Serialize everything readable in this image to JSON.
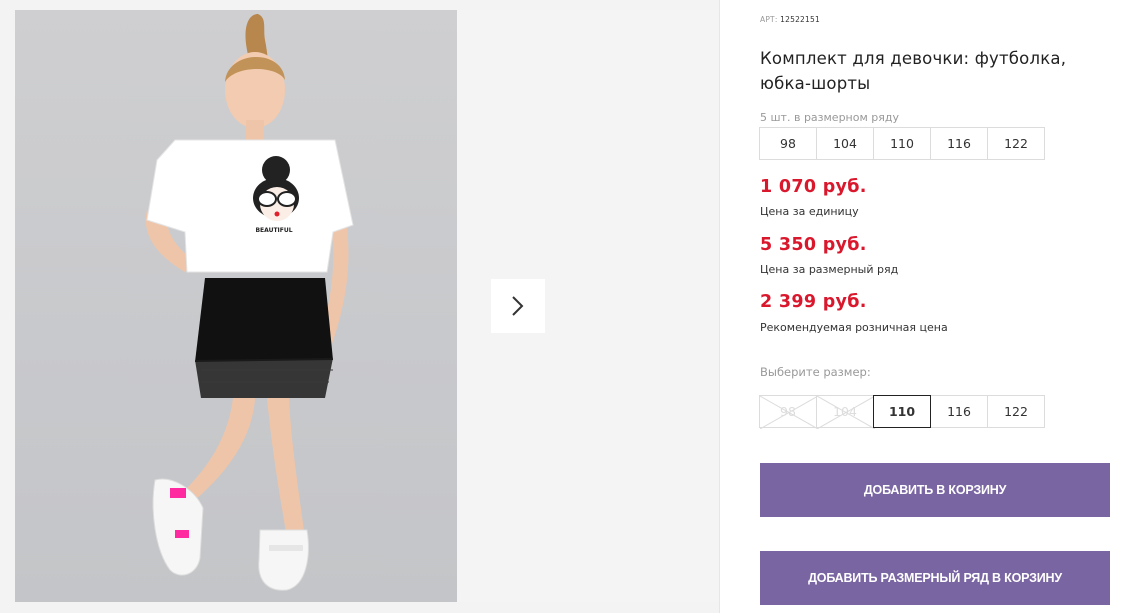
{
  "gallery": {
    "photo_alt": "",
    "next_icon": "chevron-right-icon",
    "print_text": "BEAUTIFUL"
  },
  "product": {
    "art_label": "АРТ:",
    "art_value": "12522151",
    "title": "Комплект для девочки: футболка, юбка-шорты"
  },
  "size_row": {
    "label": "5 шт. в размерном ряду",
    "sizes": [
      "98",
      "104",
      "110",
      "116",
      "122"
    ]
  },
  "prices": [
    {
      "value": "1 070 руб.",
      "note": "Цена за единицу"
    },
    {
      "value": "5 350 руб.",
      "note": "Цена за размерный ряд"
    },
    {
      "value": "2 399 руб.",
      "note": "Рекомендуемая розничная цена"
    }
  ],
  "size_select": {
    "label": "Выберите размер:",
    "options": [
      {
        "label": "98",
        "state": "disabled"
      },
      {
        "label": "104",
        "state": "disabled"
      },
      {
        "label": "110",
        "state": "selected"
      },
      {
        "label": "116",
        "state": "available"
      },
      {
        "label": "122",
        "state": "available"
      }
    ]
  },
  "buttons": {
    "add_to_cart": "ДОБАВИТЬ В КОРЗИНУ",
    "add_size_row": "ДОБАВИТЬ РАЗМЕРНЫЙ РЯД В КОРЗИНУ"
  },
  "colors": {
    "accent": "#7a65a3",
    "price": "#d9182d"
  }
}
